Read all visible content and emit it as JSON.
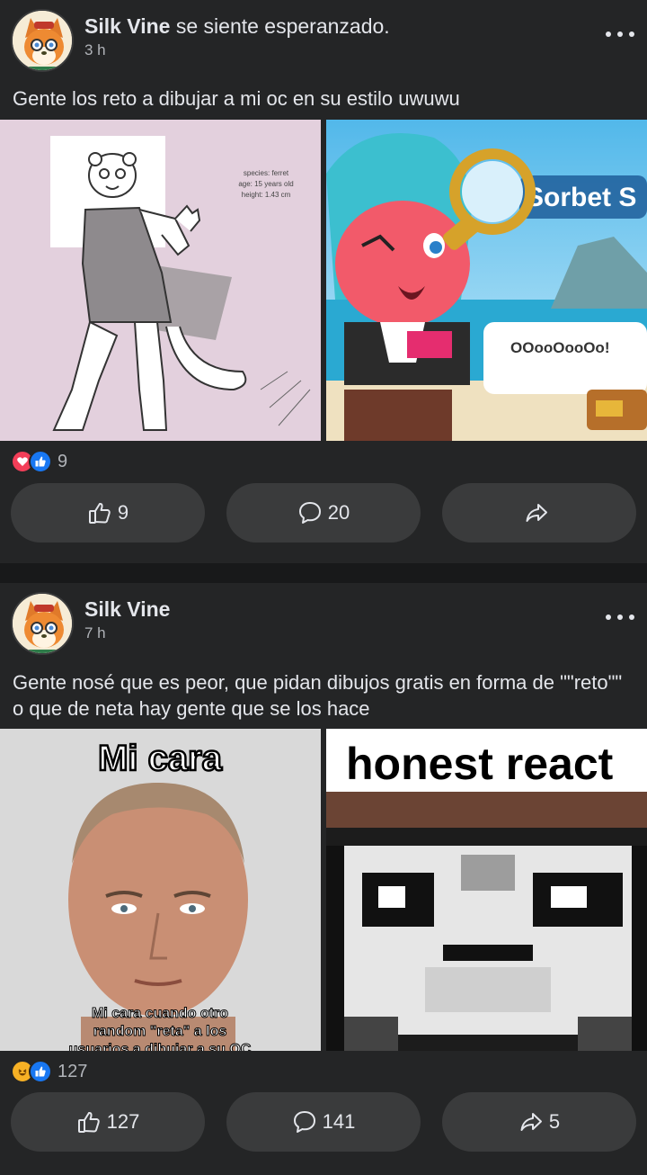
{
  "posts": [
    {
      "author": "Silk Vine",
      "feeling": " se siente esperanzado.",
      "time": "3 h",
      "text": "Gente los reto a dibujar a mi oc en su estilo uwuwu",
      "images": [
        {
          "caption_species": "species: ferret",
          "caption_age": "age: 15 years old",
          "caption_height": "height: 1.43 cm"
        },
        {
          "title": "Sorbet S",
          "speech": "OOooOooOo!"
        }
      ],
      "reactions": {
        "icons": [
          "love-icon",
          "like-icon"
        ],
        "count": "9"
      },
      "actions": {
        "like": "9",
        "comment": "20",
        "share": ""
      }
    },
    {
      "author": "Silk Vine",
      "feeling": "",
      "time": "7 h",
      "text": "Gente nosé que es peor, que pidan dibujos gratis en forma de \"\"reto\"\" o que de neta hay gente que se los hace",
      "images": [
        {
          "title": "Mi cara",
          "caption_1": "Mi cara cuando otro",
          "caption_2": "random \"reta\" a los",
          "caption_3": "usuarios a dibujar a su OC"
        },
        {
          "title": "honest react"
        }
      ],
      "reactions": {
        "icons": [
          "haha-icon",
          "like-icon"
        ],
        "count": "127"
      },
      "actions": {
        "like": "127",
        "comment": "141",
        "share": "5"
      }
    }
  ],
  "colors": {
    "background": "#242526",
    "divider": "#18191a",
    "button": "#3a3b3c",
    "text": "#e4e6eb",
    "secondary": "#b0b3b8",
    "like": "#1877f2",
    "love": "#f33e58"
  }
}
